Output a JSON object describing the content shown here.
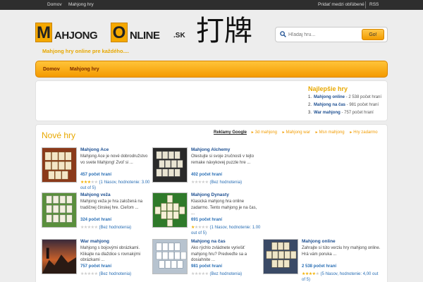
{
  "topbar": {
    "home": "Domov",
    "games": "Mahjong hry",
    "favorites": "Pridať medzi obľúbené",
    "rss": "RSS"
  },
  "header": {
    "logo_m": "M",
    "logo_ahjong": "AHJONG",
    "logo_o": "O",
    "logo_nline": "NLINE",
    "logo_sk": ".SK",
    "chinese": "打牌",
    "tagline": "Mahjong hry online pre každého...."
  },
  "search": {
    "placeholder": "Hľadaj hru...",
    "button": "Go!"
  },
  "nav": {
    "items": [
      "Domov",
      "Mahjong hry"
    ]
  },
  "best": {
    "title": "Najlepšie hry",
    "items": [
      {
        "num": "1.",
        "name": "Mahjong online",
        "count": " - 2 538 počet hraní"
      },
      {
        "num": "2.",
        "name": "Mahjong na čas",
        "count": " - 981 počet hraní"
      },
      {
        "num": "3.",
        "name": "War mahjong",
        "count": " - 757 počet hraní"
      }
    ]
  },
  "main": {
    "title": "Nové hry",
    "google_label": "Reklamy Google",
    "categories": [
      "3d mahjong",
      "Mahjong war",
      "Msn mahjong",
      "Hry zadarmo"
    ]
  },
  "games": [
    {
      "title": "Mahjong Ace",
      "desc": "Mahjong Ace je nové dobrodružstvo vo svete Mahjong! Zvoľ si ...",
      "plays": "457 počet hraní",
      "rating": "(1 hlasov, hodnotenie: 3.00 out of 5)",
      "stars": 3
    },
    {
      "title": "Mahjong Alchemy",
      "desc": "Otestujte si svoje zručnosti v tejto remake návykovej puzzle hre ...",
      "plays": "402 počet hraní",
      "rating": "(Bez hodnotenia)",
      "stars": 0
    },
    {
      "title": "Mahjong veža",
      "desc": "Mahjong veža je hra založená na tradičnej čínskej hre. Cieľom ...",
      "plays": "324 počet hraní",
      "rating": "(Bez hodnotenia)",
      "stars": 0
    },
    {
      "title": "Mahjong Dynasty",
      "desc": "Klasická mahjong hra online zadarmo. Tento mahjong je na čas, ...",
      "plays": "691 počet hraní",
      "rating": "(1 hlasov, hodnotenie: 1.00 out of 5)",
      "stars": 1
    },
    {
      "title": "War mahjong",
      "desc": "Mahjong s bojovými obrázkami. Klikajte na dlaždice s rovnakými obrázkami ...",
      "plays": "757 počet hraní",
      "rating": "(Bez hodnotenia)",
      "stars": 0
    },
    {
      "title": "Mahjong na čas",
      "desc": "Ako rýchlo zvládnete vyriešiť mahjong hru? Predveďte sa a dosiahnite ...",
      "plays": "981 počet hraní",
      "rating": "(Bez hodnotenia)",
      "stars": 0
    },
    {
      "title": "Mahjong online",
      "desc": "Zahrajte si túto verziu hry mahjong online. Hrá vám poruka ...",
      "plays": "2 538 počet hraní",
      "rating": "(5 hlasov, hodnotenie: 4,00 out of 5)",
      "stars": 4
    }
  ]
}
